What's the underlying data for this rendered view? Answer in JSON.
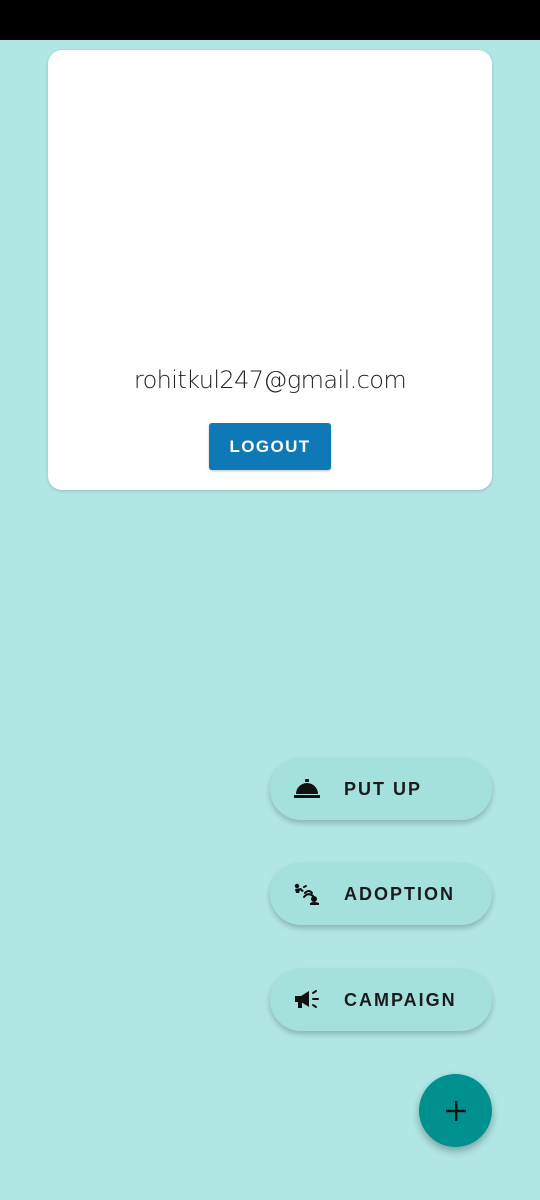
{
  "profile": {
    "email": "rohitkul247@gmail.com",
    "logout_label": "LOGOUT"
  },
  "actions": [
    {
      "label": "PUT UP",
      "icon": "room-service-icon"
    },
    {
      "label": "ADOPTION",
      "icon": "adoption-icon"
    },
    {
      "label": "CAMPAIGN",
      "icon": "megaphone-icon"
    }
  ],
  "fab": {
    "icon": "plus-icon"
  },
  "colors": {
    "background": "#b0e6e4",
    "card": "#ffffff",
    "logout_button": "#0f78b6",
    "action_button": "#a4e0dc",
    "fab": "#009090",
    "status_bar": "#000000"
  }
}
